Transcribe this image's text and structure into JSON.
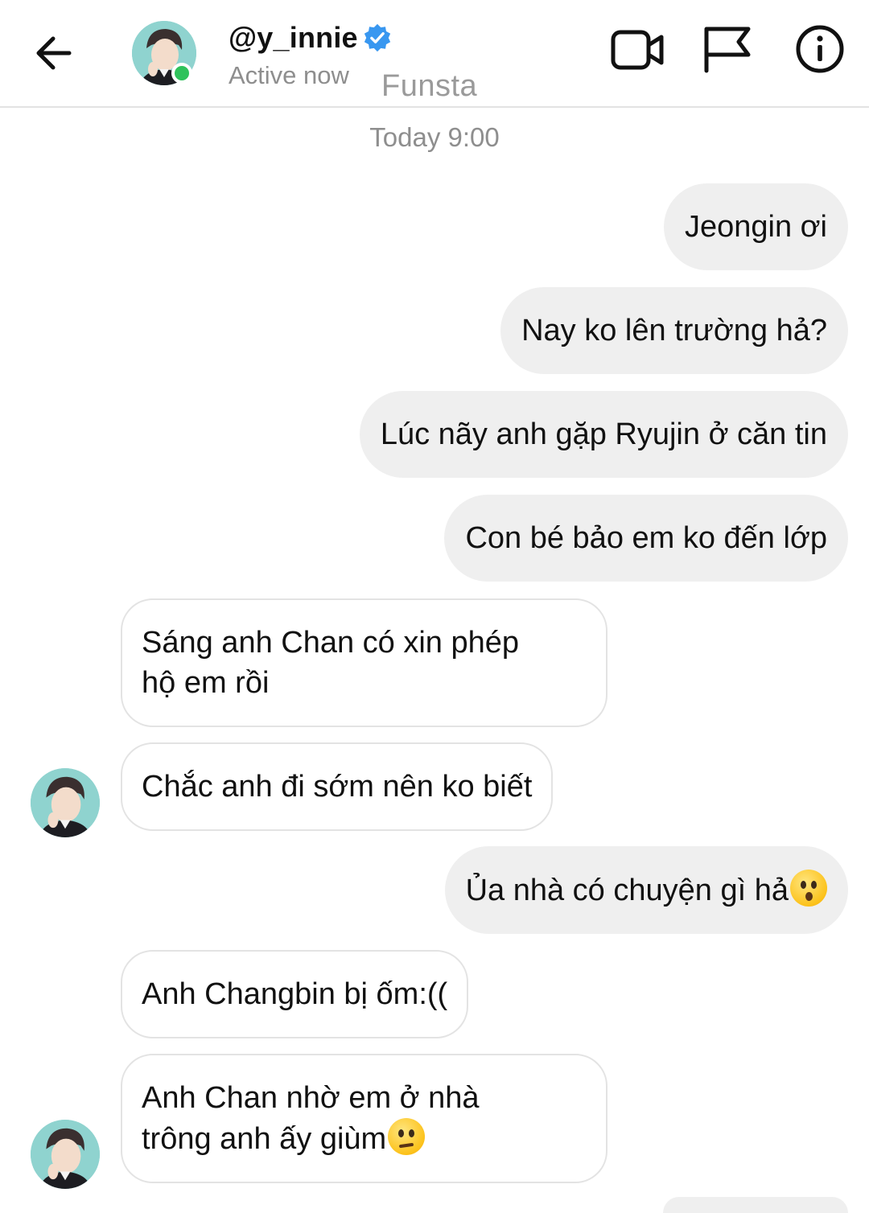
{
  "header": {
    "username": "@y_innie",
    "status": "Active now",
    "account_label": "Funsta",
    "icons": {
      "back": "arrow-left-icon",
      "verified": "verified-badge-icon",
      "video": "video-camera-icon",
      "report": "flag-icon",
      "info": "info-icon"
    },
    "online_color": "#2fc25b"
  },
  "timestamp": "Today 9:00",
  "messages": [
    {
      "side": "outgoing",
      "text": "Jeongin ơi"
    },
    {
      "side": "outgoing",
      "text": "Nay ko lên trường hả?"
    },
    {
      "side": "outgoing",
      "text": "Lúc nãy anh gặp Ryujin ở căn tin"
    },
    {
      "side": "outgoing",
      "text": "Con bé bảo em ko đến lớp"
    },
    {
      "side": "incoming",
      "line1": "Sáng anh Chan có xin phép",
      "line2": "hộ em rồi"
    },
    {
      "side": "incoming",
      "text": "Chắc anh đi sớm nên ko biết"
    },
    {
      "side": "outgoing",
      "text": "Ủa nhà có chuyện gì hả",
      "emoji": "hushed-face-emoji"
    },
    {
      "side": "incoming",
      "text": "Anh Changbin bị ốm:(("
    },
    {
      "side": "incoming",
      "line1": "Anh Chan nhờ em ở nhà",
      "line2": "trông anh ấy giùm",
      "emoji": "confused-face-emoji"
    }
  ],
  "colors": {
    "outgoing_bubble": "#efefef",
    "incoming_border": "#e3e3e3",
    "verified": "#3897f0",
    "muted_text": "#8e8e8e"
  }
}
